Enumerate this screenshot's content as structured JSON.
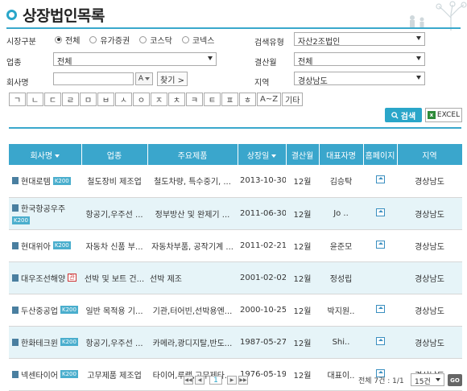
{
  "page": {
    "title": "상장법인목록"
  },
  "filters": {
    "market_label": "시장구분",
    "market_options": [
      "전체",
      "유가증권",
      "코스닥",
      "코넥스"
    ],
    "search_type_label": "검색유형",
    "search_type_value": "자산2조법인",
    "industry_label": "업종",
    "industry_value": "전체",
    "fiscal_label": "결산월",
    "fiscal_value": "전체",
    "company_label": "회사명",
    "company_value": "",
    "a_button": "A",
    "find_button": "찾기 >",
    "region_label": "지역",
    "region_value": "경상남도",
    "index_keys": [
      "ㄱ",
      "ㄴ",
      "ㄷ",
      "ㄹ",
      "ㅁ",
      "ㅂ",
      "ㅅ",
      "ㅇ",
      "ㅈ",
      "ㅊ",
      "ㅋ",
      "ㅌ",
      "ㅍ",
      "ㅎ",
      "A~Z",
      "기타"
    ],
    "search_button": "검색",
    "excel_button": "EXCEL"
  },
  "table": {
    "headers": [
      "회사명",
      "업종",
      "주요제품",
      "상장일",
      "결산월",
      "대표자명",
      "홈페이지",
      "지역"
    ],
    "rows": [
      {
        "name": "현대로템",
        "badge": "K200",
        "industry": "철도장비 제조업",
        "products": "철도차량, 특수중기, ...",
        "listed": "2013-10-30",
        "month": "12월",
        "ceo": "김승탁",
        "region": "경상남도"
      },
      {
        "name": "한국항공우주",
        "badge": "K200",
        "industry": "항공기,우주선 ...",
        "products": "정부방산 및 완제기 ...",
        "listed": "2011-06-30",
        "month": "12월",
        "ceo": "Jo ..",
        "region": "경상남도"
      },
      {
        "name": "현대위아",
        "badge": "K200",
        "industry": "자동차 신품 부...",
        "products": "자동차부품, 공작기계 ...",
        "listed": "2011-02-21",
        "month": "12월",
        "ceo": "윤준모",
        "region": "경상남도"
      },
      {
        "name": "대우조선해양",
        "badge": "관",
        "industry": "선박 및 보트 건...",
        "products": "선박 제조",
        "listed": "2001-02-02",
        "month": "12월",
        "ceo": "정성립",
        "region": "경상남도"
      },
      {
        "name": "두산중공업",
        "badge": "K200",
        "industry": "일반 목적용 기...",
        "products": "기관,터어빈,선박용엔...",
        "listed": "2000-10-25",
        "month": "12월",
        "ceo": "박지원..",
        "region": "경상남도"
      },
      {
        "name": "한화테크윈",
        "badge": "K200",
        "industry": "항공기,우주선 ...",
        "products": "카메라,광디지탈,반도...",
        "listed": "1987-05-27",
        "month": "12월",
        "ceo": "Shi..",
        "region": "경상남도"
      },
      {
        "name": "넥센타이어",
        "badge": "K200",
        "industry": "고무제품 제조업",
        "products": "타이어,루랩,고무제타...",
        "listed": "1976-05-19",
        "month": "12월",
        "ceo": "대표이..",
        "region": "경상남도"
      }
    ]
  },
  "pager": {
    "current": "1",
    "total_text": "전체 7건 : 1/1",
    "per_page": "15건",
    "go": "GO"
  }
}
